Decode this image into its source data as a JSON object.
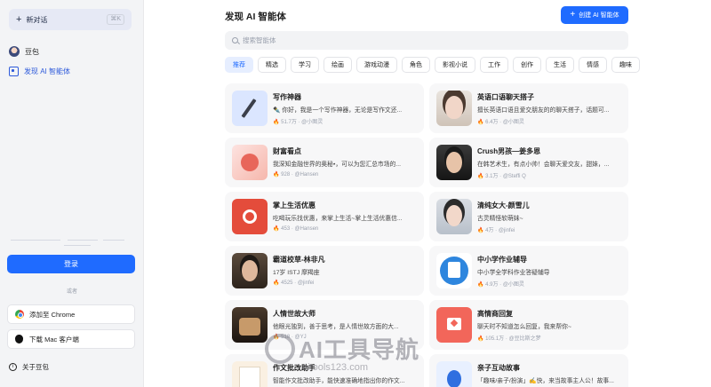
{
  "sidebar": {
    "new_chat": {
      "label": "新对话",
      "shortcut": "⌘K"
    },
    "items": [
      {
        "label": "豆包"
      },
      {
        "label": "发现 AI 智能体"
      }
    ],
    "login": "登录",
    "or": "或者",
    "chrome": "添加至 Chrome",
    "mac": "下载 Mac 客户端",
    "about": "关于豆包"
  },
  "main": {
    "title": "发现 AI 智能体",
    "create": "创建 AI 智能体",
    "search_placeholder": "搜索智能体",
    "tabs": [
      "推荐",
      "精选",
      "学习",
      "绘画",
      "游戏动漫",
      "角色",
      "影视小说",
      "工作",
      "创作",
      "生活",
      "情感",
      "趣味"
    ],
    "cards": [
      {
        "name": "写作神器",
        "desc": "✒️ 你好，我是一个写作神器，无论是写作文还...",
        "count": "51.7万",
        "author": "@小图灵"
      },
      {
        "name": "英语口语聊天搭子",
        "desc": "擅长英语口语且爱交朋友的的聊天搭子，话题可...",
        "count": "6.4万",
        "author": "@小图灵"
      },
      {
        "name": "财富看点",
        "desc": "我深知金融世界的奥秘•，可以为您汇总市场的...",
        "count": "928",
        "author": "@Hansen"
      },
      {
        "name": "Crush男孩—姜多恩",
        "desc": "在韩艺术生，有点小帅！会聊天爱交友，甜妹，...",
        "count": "3.1万",
        "author": "@Steffi Q"
      },
      {
        "name": "掌上生活优惠",
        "desc": "吃喝玩乐找优惠，来掌上生活~掌上生活优惠信...",
        "count": "453",
        "author": "@Hansen"
      },
      {
        "name": "清纯女大-颜雪儿",
        "desc": "古灵精怪软萌妹~",
        "count": "4万",
        "author": "@jinfei"
      },
      {
        "name": "霸道校草-林非凡",
        "desc": "17岁 ISTJ 摩羯座",
        "count": "4525",
        "author": "@jinfei"
      },
      {
        "name": "中小学作业辅导",
        "desc": "中小学全学科作业答疑辅导",
        "count": "4.9万",
        "author": "@小图灵"
      },
      {
        "name": "人情世故大师",
        "desc": "他眼光独到，善于思考，是人情世故方面的大...",
        "count": "518",
        "author": "@YJ"
      },
      {
        "name": "高情商回复",
        "desc": "聊天时不知道怎么回复，我来帮你~",
        "count": "105.1万",
        "author": "@豆比斯之梦"
      },
      {
        "name": "作文批改助手",
        "desc": "智能作文批改助手，能快速准确地指出你的作文...",
        "count": "",
        "author": ""
      },
      {
        "name": "亲子互动故事",
        "desc": "「趣味/亲子/扮演」✍️快，来当故事主人公！故事...",
        "count": "",
        "author": ""
      }
    ]
  },
  "watermark": {
    "title": "AI工具导航",
    "subtitle": "aitools123.com"
  }
}
